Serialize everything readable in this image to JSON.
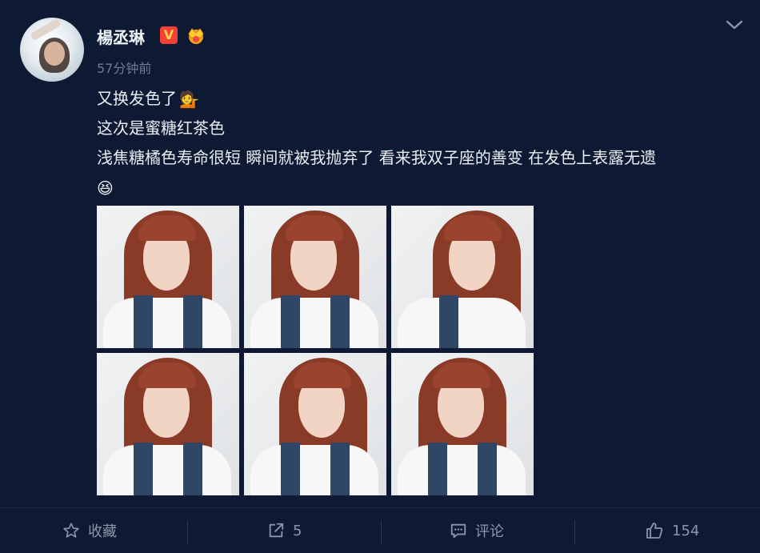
{
  "author": {
    "name": "楊丞琳",
    "verified_badge": "V",
    "timestamp": "57分钟前"
  },
  "post": {
    "lines": [
      "又换发色了",
      "这次是蜜糖红茶色",
      "浅焦糖橘色寿命很短 瞬间就被我抛弃了 看来我双子座的善变 在发色上表露无遗"
    ],
    "emoji_1": "💁",
    "emoji_2": "😆"
  },
  "photos": [
    {
      "alt_icon": "selfie-photo-1"
    },
    {
      "alt_icon": "selfie-photo-2"
    },
    {
      "alt_icon": "selfie-photo-3"
    },
    {
      "alt_icon": "selfie-photo-4"
    },
    {
      "alt_icon": "selfie-photo-5"
    },
    {
      "alt_icon": "selfie-photo-6"
    }
  ],
  "actions": {
    "favorite_label": "收藏",
    "repost_count": "5",
    "comment_label": "评论",
    "like_count": "154"
  },
  "colors": {
    "background": "#0e1a33",
    "muted_text": "#8a96aa",
    "badge_red": "#f44336",
    "badge_gold": "#ffd24d"
  }
}
